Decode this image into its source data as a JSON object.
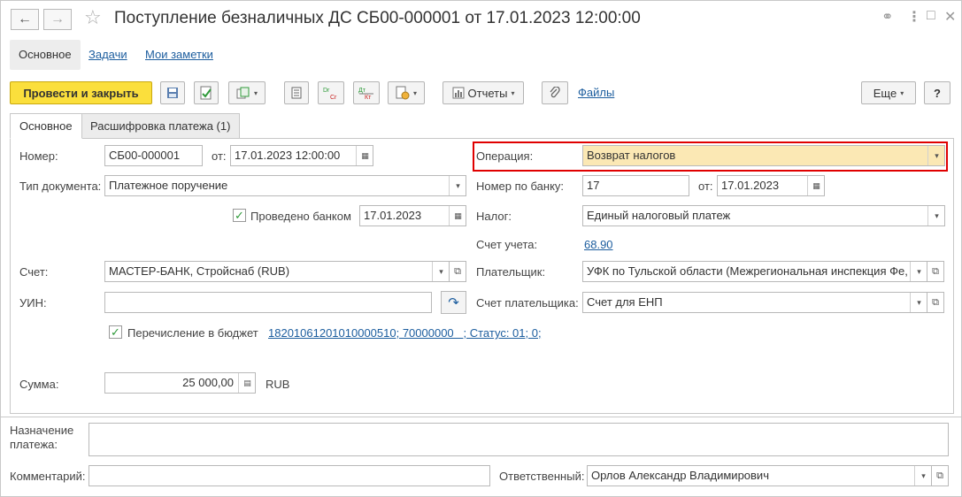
{
  "window": {
    "title": "Поступление безналичных ДС СБ00-000001 от 17.01.2023 12:00:00",
    "nav_back": "←",
    "nav_forward": "→",
    "star": "☆",
    "link_icon": "⚭",
    "menu_icon": "⋮",
    "restore_icon": "□",
    "close_icon": "✕"
  },
  "top_tabs": [
    {
      "label": "Основное"
    },
    {
      "label": "Задачи"
    },
    {
      "label": "Мои заметки"
    }
  ],
  "toolbar": {
    "post_close": "Провести и закрыть",
    "reports": "Отчеты",
    "files": "Файлы",
    "more": "Еще",
    "help": "?",
    "dropdown": "▾"
  },
  "inner_tabs": [
    {
      "label": "Основное"
    },
    {
      "label": "Расшифровка платежа (1)"
    }
  ],
  "form": {
    "number_label": "Номер:",
    "number_value": "СБ00-000001",
    "from_label": "от:",
    "date_value": "17.01.2023 12:00:00",
    "doctype_label": "Тип документа:",
    "doctype_value": "Платежное поручение",
    "bank_posted_label": "Проведено банком",
    "bank_posted_date": "17.01.2023",
    "check_mark": "✓",
    "account_label": "Счет:",
    "account_value": "МАСТЕР-БАНК, Стройснаб (RUB)",
    "uin_label": "УИН:",
    "uin_value": "",
    "budget_label": "Перечисление в бюджет",
    "budget_link": "18201061201010000510; 70000000   ; Статус: 01; 0;",
    "sum_label": "Сумма:",
    "sum_value": "25 000,00",
    "currency": "RUB",
    "operation_label": "Операция:",
    "operation_value": "Возврат налогов",
    "bank_number_label": "Номер по банку:",
    "bank_number_value": "17",
    "bank_date_label": "от:",
    "bank_date_value": "17.01.2023",
    "tax_label": "Налог:",
    "tax_value": "Единый налоговый платеж",
    "ledger_label": "Счет учета:",
    "ledger_value": "68.90",
    "payer_label": "Плательщик:",
    "payer_value": "УФК по Тульской области (Межрегиональная инспекция Фе,",
    "payer_account_label": "Счет плательщика:",
    "payer_account_value": "Счет для ЕНП"
  },
  "footer": {
    "purpose_label_1": "Назначение",
    "purpose_label_2": "платежа:",
    "purpose_value": "",
    "comment_label": "Комментарий:",
    "comment_value": "",
    "responsible_label": "Ответственный:",
    "responsible_value": "Орлов Александр Владимирович"
  }
}
